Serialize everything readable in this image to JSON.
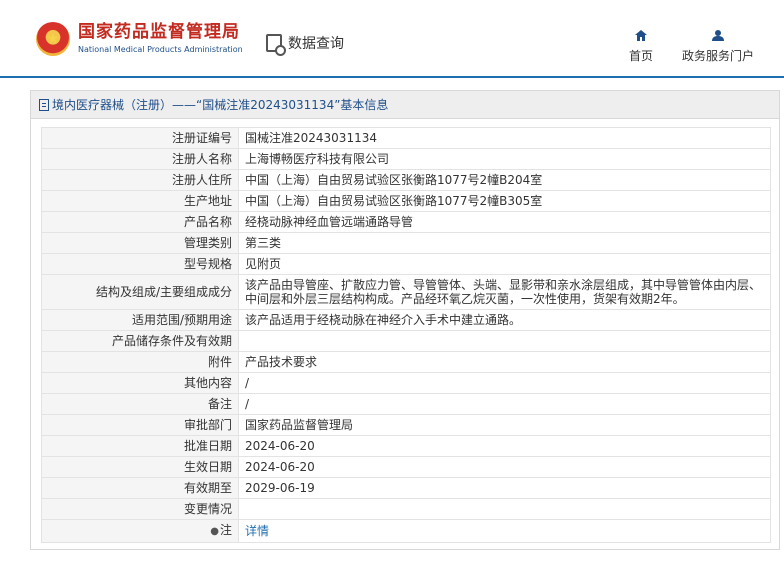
{
  "header": {
    "logo_cn": "国家药品监督管理局",
    "logo_en": "National Medical Products Administration",
    "data_query": "数据查询",
    "nav": [
      {
        "label": "首页",
        "icon": "home-icon"
      },
      {
        "label": "政务服务门户",
        "icon": "user-icon"
      }
    ]
  },
  "panel": {
    "title": "境内医疗器械（注册）——“国械注准20243031134”基本信息"
  },
  "rows": [
    {
      "k": "注册证编号",
      "v": "国械注准20243031134"
    },
    {
      "k": "注册人名称",
      "v": "上海博畅医疗科技有限公司"
    },
    {
      "k": "注册人住所",
      "v": "中国（上海）自由贸易试验区张衡路1077号2幢B204室"
    },
    {
      "k": "生产地址",
      "v": "中国（上海）自由贸易试验区张衡路1077号2幢B305室"
    },
    {
      "k": "产品名称",
      "v": "经桡动脉神经血管远端通路导管"
    },
    {
      "k": "管理类别",
      "v": "第三类"
    },
    {
      "k": "型号规格",
      "v": "见附页"
    },
    {
      "k": "结构及组成/主要组成成分",
      "v": "该产品由导管座、扩散应力管、导管管体、头端、显影带和亲水涂层组成，其中导管管体由内层、中间层和外层三层结构构成。产品经环氧乙烷灭菌，一次性使用，货架有效期2年。"
    },
    {
      "k": "适用范围/预期用途",
      "v": "该产品适用于经桡动脉在神经介入手术中建立通路。"
    },
    {
      "k": "产品储存条件及有效期",
      "v": ""
    },
    {
      "k": "附件",
      "v": "产品技术要求"
    },
    {
      "k": "其他内容",
      "v": "/"
    },
    {
      "k": "备注",
      "v": "/"
    },
    {
      "k": "审批部门",
      "v": "国家药品监督管理局"
    },
    {
      "k": "批准日期",
      "v": "2024-06-20"
    },
    {
      "k": "生效日期",
      "v": "2024-06-20"
    },
    {
      "k": "有效期至",
      "v": "2029-06-19"
    },
    {
      "k": "变更情况",
      "v": ""
    }
  ],
  "note": {
    "k": "注",
    "v": "详情"
  },
  "colors": {
    "brand_red": "#c32a20",
    "brand_blue": "#1f4f8a",
    "link": "#1f6fb0"
  }
}
